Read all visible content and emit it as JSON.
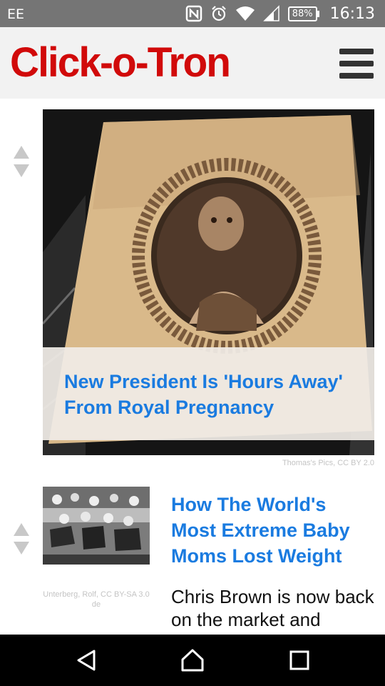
{
  "status_bar": {
    "carrier": "EE",
    "battery": "88%",
    "time": "16:13"
  },
  "app": {
    "title": "Click-o-Tron"
  },
  "feed": [
    {
      "title": "New President Is 'Hours Away' From Royal Pregnancy",
      "image_credit": "Thomas's Pics, CC BY 2.0"
    },
    {
      "title": "How The World's Most Extreme Baby Moms Lost Weight",
      "image_credit": "Unterberg, Rolf, CC BY-SA 3.0 de",
      "snippet": "Chris Brown is now back on the market and"
    }
  ],
  "icons": {
    "status": [
      "nfc-icon",
      "alarm-icon",
      "wifi-icon",
      "signal-icon",
      "battery-icon"
    ],
    "nav": [
      "back-icon",
      "home-icon",
      "recents-icon"
    ],
    "vote": [
      "upvote-arrow-icon",
      "downvote-arrow-icon"
    ]
  },
  "colors": {
    "brand": "#d10a0a",
    "headline": "#1a7be0",
    "status_bar": "#757575",
    "app_bar": "#f2f2f2"
  }
}
